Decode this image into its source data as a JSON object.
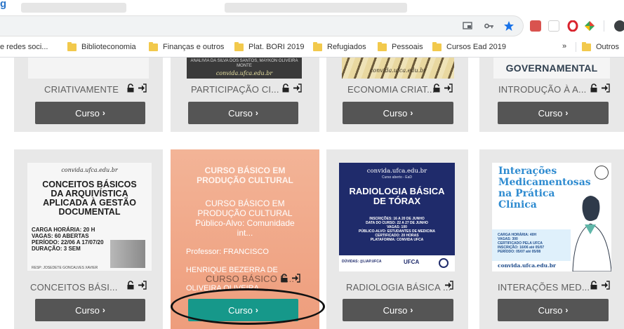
{
  "window_fragment": "g",
  "toolbar": {
    "icons": [
      "cast-icon",
      "key-icon",
      "star-icon",
      "pdf-extension-icon",
      "extension-box-icon",
      "opera-extension-icon",
      "colorful-extension-icon",
      "profile-icon"
    ],
    "star_color": "#1a73e8"
  },
  "bookmarks": {
    "items": [
      {
        "label": "e redes soci...",
        "folder": false
      },
      {
        "label": "Biblioteconomia",
        "folder": true
      },
      {
        "label": "Finanças e outros",
        "folder": true
      },
      {
        "label": "Plat. BORI 2019",
        "folder": true
      },
      {
        "label": "Refugiados",
        "folder": true
      },
      {
        "label": "Pessoais",
        "folder": true
      },
      {
        "label": "Cursos Ead 2019",
        "folder": true
      }
    ],
    "more_label": "»",
    "others_label": "Outros"
  },
  "row1": [
    {
      "title": "CRIATIVAMENTE",
      "button": "Curso",
      "lock": true
    },
    {
      "title": "PARTICIPAÇÃO CI...",
      "button": "Curso",
      "lock": true,
      "thumb_lines": [
        "ANALIVIA DA SILVA DOS SANTOS, MAYKON OLIVEIRA",
        "MONTE"
      ],
      "thumb_url": "convida.ufca.edu.br"
    },
    {
      "title": "ECONOMIA CRIAT...",
      "button": "Curso",
      "lock": true,
      "thumb_url": "convida.ufca.edu.br"
    },
    {
      "title": "INTRODUÇÃO À A...",
      "button": "Curso",
      "lock": true,
      "thumb_heading": "GOVERNAMENTAL"
    }
  ],
  "row2": [
    {
      "title": "CONCEITOS BÁSI...",
      "button": "Curso",
      "lock": true,
      "thumb": {
        "url": "convida.ufca.edu.br",
        "title_lines": [
          "CONCEITOS BÁSICOS",
          "DA ARQUIVÍSTICA",
          "APLICADA À GESTÃO",
          "DOCUMENTAL"
        ],
        "info_lines": [
          "CARGA HORÁRIA: 20 H",
          "VAGAS: 60 ABERTAS",
          "PERÍODO: 22/06 A 17/07/20",
          "DURAÇÃO: 3 SEM"
        ],
        "resp": "RESP: JOSEDETE GONCALVES XAVIER"
      }
    },
    {
      "title": "CURSO BÁSICO E...",
      "button": "Curso",
      "lock": true,
      "highlighted": true,
      "thumb": {
        "title_lines": [
          "CURSO BÁSICO EM",
          "PRODUÇÃO CULTURAL"
        ],
        "overlay_lines": [
          "CURSO BÁSICO EM",
          "PRODUÇÃO CULTURAL",
          "Público-Alvo: Comunidade",
          "int..."
        ],
        "professor_lines": [
          "Professor: FRANCISCO",
          "HENRIQUE BEZERRA DE",
          "OLIVEIRA OLIVEIRA"
        ]
      }
    },
    {
      "title": "RADIOLOGIA BÁSICA ...",
      "button": "Curso",
      "lock": false,
      "thumb": {
        "url": "convida.ufca.edu.br",
        "subtitle": "Curso aberto - EaD",
        "title_lines": [
          "RADIOLOGIA BÁSICA",
          "DE TÓRAX"
        ],
        "info_lines": [
          "INSCRIÇÕES: 16 A 20 DE JUNHO",
          "DATA DO CURSO: 22 A 27 DE JUNHO",
          "VAGAS: 100",
          "PÚBLICO-ALVO: ESTUDANTES DE MEDICINA",
          "CERTIFICADO: 20 HORAS",
          "PLATAFORMA: CONVIDA UFCA"
        ],
        "footer": "DÚVIDAS: @LIAP.UFCA",
        "logo": "UFCA"
      }
    },
    {
      "title": "INTERAÇÕES MED...",
      "button": "Curso",
      "lock": true,
      "thumb": {
        "title_lines": [
          "Interações",
          "Medicamentosas",
          "na Prática",
          "Clínica"
        ],
        "info_lines": [
          "CARGA HORÁRIA: 40H",
          "VAGAS: 300",
          "CERTIFICADO PELA UFCA",
          "INSCRIÇÃO: 16/06 até 05/07",
          "PERÍODO: 05/07 até 05/08"
        ],
        "url": "convida.ufca.edu.br"
      }
    }
  ],
  "colors": {
    "button": "#555555",
    "button_highlight": "#16988a",
    "card_bg": "#e8e8e8",
    "highlight_card": "#f0a98a"
  }
}
